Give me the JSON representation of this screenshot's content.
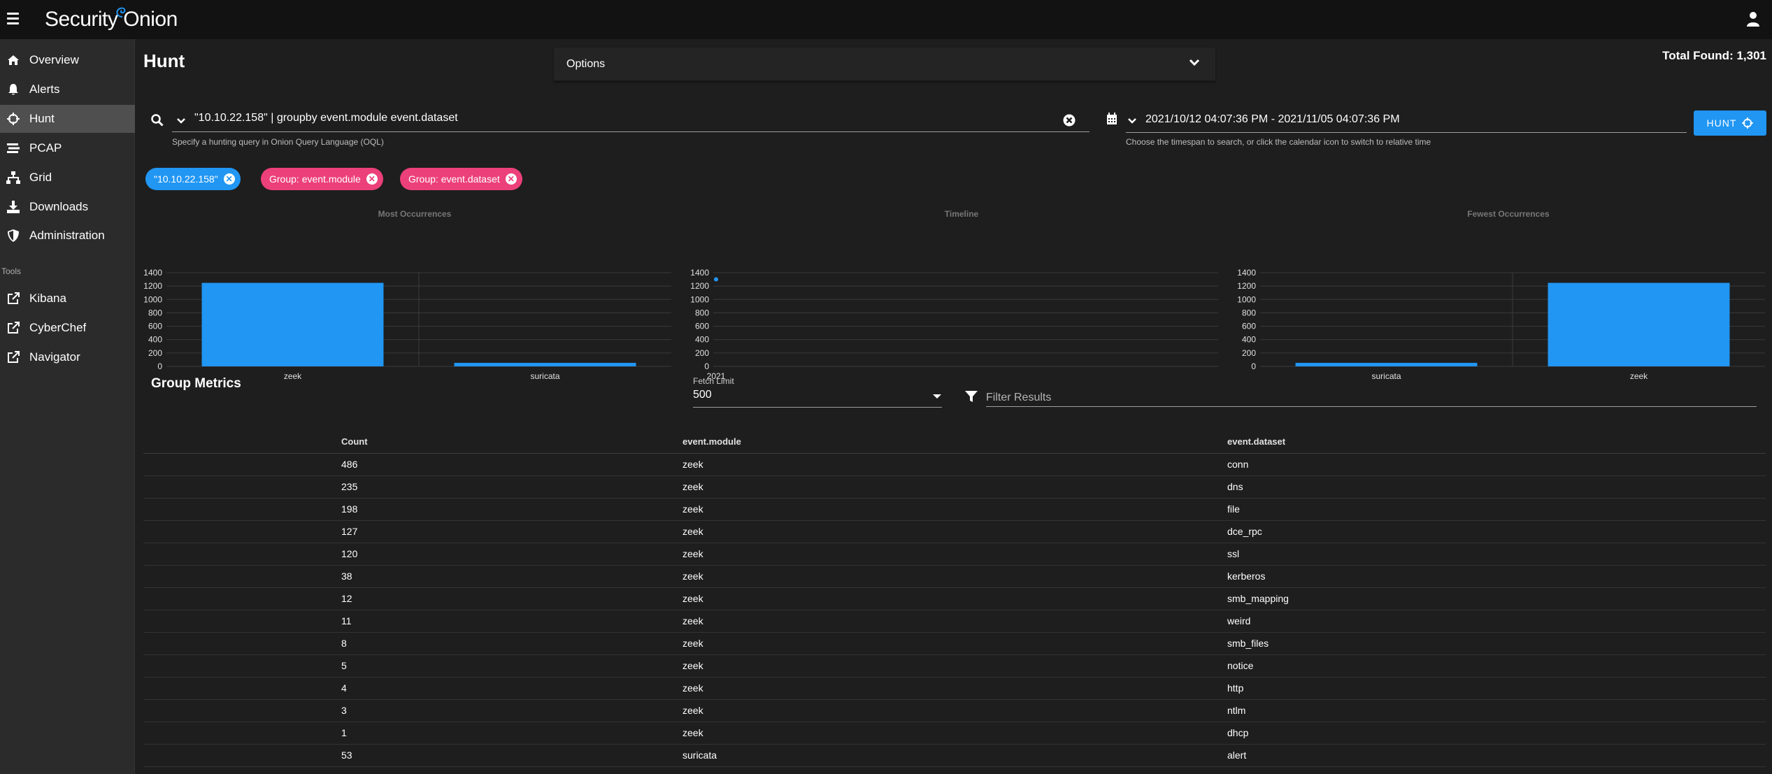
{
  "app": {
    "logo_text": "Security Onion"
  },
  "sidebar": {
    "items": [
      {
        "label": "Overview",
        "icon": "home-icon"
      },
      {
        "label": "Alerts",
        "icon": "bell-icon"
      },
      {
        "label": "Hunt",
        "icon": "crosshairs-icon",
        "active": true
      },
      {
        "label": "PCAP",
        "icon": "stream-icon"
      },
      {
        "label": "Grid",
        "icon": "network-icon"
      },
      {
        "label": "Downloads",
        "icon": "download-icon"
      },
      {
        "label": "Administration",
        "icon": "shield-icon"
      }
    ],
    "tools_label": "Tools",
    "tools": [
      {
        "label": "Kibana",
        "icon": "external-link-icon"
      },
      {
        "label": "CyberChef",
        "icon": "external-link-icon"
      },
      {
        "label": "Navigator",
        "icon": "external-link-icon"
      }
    ]
  },
  "header": {
    "title": "Hunt",
    "total_found": "Total Found: 1,301",
    "options_label": "Options"
  },
  "query": {
    "value": "\"10.10.22.158\" | groupby event.module event.dataset",
    "hint": "Specify a hunting query in Onion Query Language (OQL)"
  },
  "daterange": {
    "value": "2021/10/12 04:07:36 PM - 2021/11/05 04:07:36 PM",
    "hint": "Choose the timespan to search, or click the calendar icon to switch to relative time"
  },
  "hunt_button": "HUNT",
  "chips": [
    {
      "label": "\"10.10.22.158\"",
      "color": "#2196f3"
    },
    {
      "label": "Group: event.module",
      "color": "#ec407a"
    },
    {
      "label": "Group: event.dataset",
      "color": "#ec407a"
    }
  ],
  "chart_data": [
    {
      "type": "bar",
      "title": "Most Occurrences",
      "categories": [
        "zeek",
        "suricata"
      ],
      "values": [
        1248,
        53
      ],
      "ylim": [
        0,
        1400
      ],
      "yticks": [
        0,
        200,
        400,
        600,
        800,
        1000,
        1200,
        1400
      ],
      "color": "#2196f3"
    },
    {
      "type": "scatter",
      "title": "Timeline",
      "categories": [
        "2021"
      ],
      "values": [
        1301
      ],
      "ylim": [
        0,
        1400
      ],
      "yticks": [
        0,
        200,
        400,
        600,
        800,
        1000,
        1200,
        1400
      ],
      "color": "#2196f3"
    },
    {
      "type": "bar",
      "title": "Fewest Occurrences",
      "categories": [
        "suricata",
        "zeek"
      ],
      "values": [
        53,
        1248
      ],
      "ylim": [
        0,
        1400
      ],
      "yticks": [
        0,
        200,
        400,
        600,
        800,
        1000,
        1200,
        1400
      ],
      "color": "#2196f3"
    }
  ],
  "group_metrics": {
    "title": "Group Metrics",
    "fetch_limit_label": "Fetch Limit",
    "fetch_limit_value": "500",
    "filter_placeholder": "Filter Results",
    "columns": [
      "Count",
      "event.module",
      "event.dataset"
    ],
    "rows": [
      [
        "486",
        "zeek",
        "conn"
      ],
      [
        "235",
        "zeek",
        "dns"
      ],
      [
        "198",
        "zeek",
        "file"
      ],
      [
        "127",
        "zeek",
        "dce_rpc"
      ],
      [
        "120",
        "zeek",
        "ssl"
      ],
      [
        "38",
        "zeek",
        "kerberos"
      ],
      [
        "12",
        "zeek",
        "smb_mapping"
      ],
      [
        "11",
        "zeek",
        "weird"
      ],
      [
        "8",
        "zeek",
        "smb_files"
      ],
      [
        "5",
        "zeek",
        "notice"
      ],
      [
        "4",
        "zeek",
        "http"
      ],
      [
        "3",
        "zeek",
        "ntlm"
      ],
      [
        "1",
        "zeek",
        "dhcp"
      ],
      [
        "53",
        "suricata",
        "alert"
      ]
    ]
  }
}
